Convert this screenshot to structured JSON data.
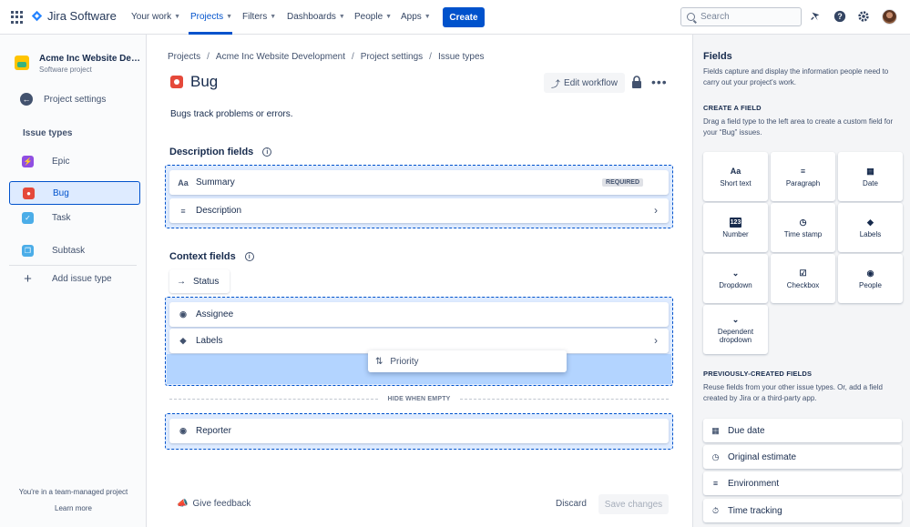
{
  "app": {
    "name": "Jira Software"
  },
  "topnav": {
    "items": [
      {
        "label": "Your work"
      },
      {
        "label": "Projects"
      },
      {
        "label": "Filters"
      },
      {
        "label": "Dashboards"
      },
      {
        "label": "People"
      },
      {
        "label": "Apps"
      }
    ],
    "active": "Projects",
    "create_label": "Create",
    "search_placeholder": "Search"
  },
  "sidebar": {
    "project_name": "Acme Inc Website Development",
    "project_type": "Software project",
    "back_label": "Project settings",
    "section_title": "Issue types",
    "items": [
      {
        "label": "Epic",
        "icon": "epic-icon",
        "color": "#904EE2"
      },
      {
        "label": "Bug",
        "icon": "bug-icon",
        "color": "#E5493A"
      },
      {
        "label": "Task",
        "icon": "task-icon",
        "color": "#4BADE8"
      },
      {
        "label": "Subtask",
        "icon": "subtask-icon",
        "color": "#4BADE8"
      },
      {
        "label": "Add issue type",
        "icon": "plus-icon"
      }
    ],
    "selected": "Bug",
    "team_note": "You're in a team-managed project",
    "learn_more": "Learn more"
  },
  "breadcrumbs": [
    "Projects",
    "Acme Inc Website Development",
    "Project settings",
    "Issue types"
  ],
  "header": {
    "title": "Bug",
    "edit_workflow": "Edit workflow",
    "description": "Bugs track problems or errors."
  },
  "description_fields": {
    "title": "Description fields",
    "fields": [
      {
        "label": "Summary",
        "icon": "text-icon",
        "badge": "REQUIRED"
      },
      {
        "label": "Description",
        "icon": "paragraph-icon"
      }
    ]
  },
  "context_fields": {
    "title": "Context fields",
    "status_label": "Status",
    "fields": [
      {
        "label": "Assignee",
        "icon": "person-icon"
      },
      {
        "label": "Labels",
        "icon": "tag-icon"
      }
    ],
    "dragging": "Priority",
    "hide_when_empty": "HIDE WHEN EMPTY",
    "hidden_fields": [
      {
        "label": "Reporter",
        "icon": "person-icon"
      }
    ]
  },
  "footer": {
    "feedback": "Give feedback",
    "discard": "Discard",
    "save": "Save changes"
  },
  "right_panel": {
    "title": "Fields",
    "description": "Fields capture and display the information people need to carry out your project's work.",
    "create_heading": "CREATE A FIELD",
    "create_desc": "Drag a field type to the left area to create a custom field for your “Bug” issues.",
    "tiles": [
      {
        "label": "Short text",
        "icon": "short-text-icon"
      },
      {
        "label": "Paragraph",
        "icon": "paragraph-icon"
      },
      {
        "label": "Date",
        "icon": "calendar-icon"
      },
      {
        "label": "Number",
        "icon": "number-icon"
      },
      {
        "label": "Time stamp",
        "icon": "clock-icon"
      },
      {
        "label": "Labels",
        "icon": "tag-icon"
      },
      {
        "label": "Dropdown",
        "icon": "dropdown-icon"
      },
      {
        "label": "Checkbox",
        "icon": "checkbox-icon"
      },
      {
        "label": "People",
        "icon": "person-icon"
      },
      {
        "label": "Dependent dropdown",
        "icon": "dependent-dropdown-icon"
      }
    ],
    "previous_heading": "PREVIOUSLY-CREATED FIELDS",
    "previous_desc": "Reuse fields from your other issue types. Or, add a field created by Jira or a third-party app.",
    "previous_fields": [
      {
        "label": "Due date",
        "icon": "calendar-icon"
      },
      {
        "label": "Original estimate",
        "icon": "clock-icon"
      },
      {
        "label": "Environment",
        "icon": "paragraph-icon"
      },
      {
        "label": "Time tracking",
        "icon": "stopwatch-icon"
      }
    ]
  }
}
